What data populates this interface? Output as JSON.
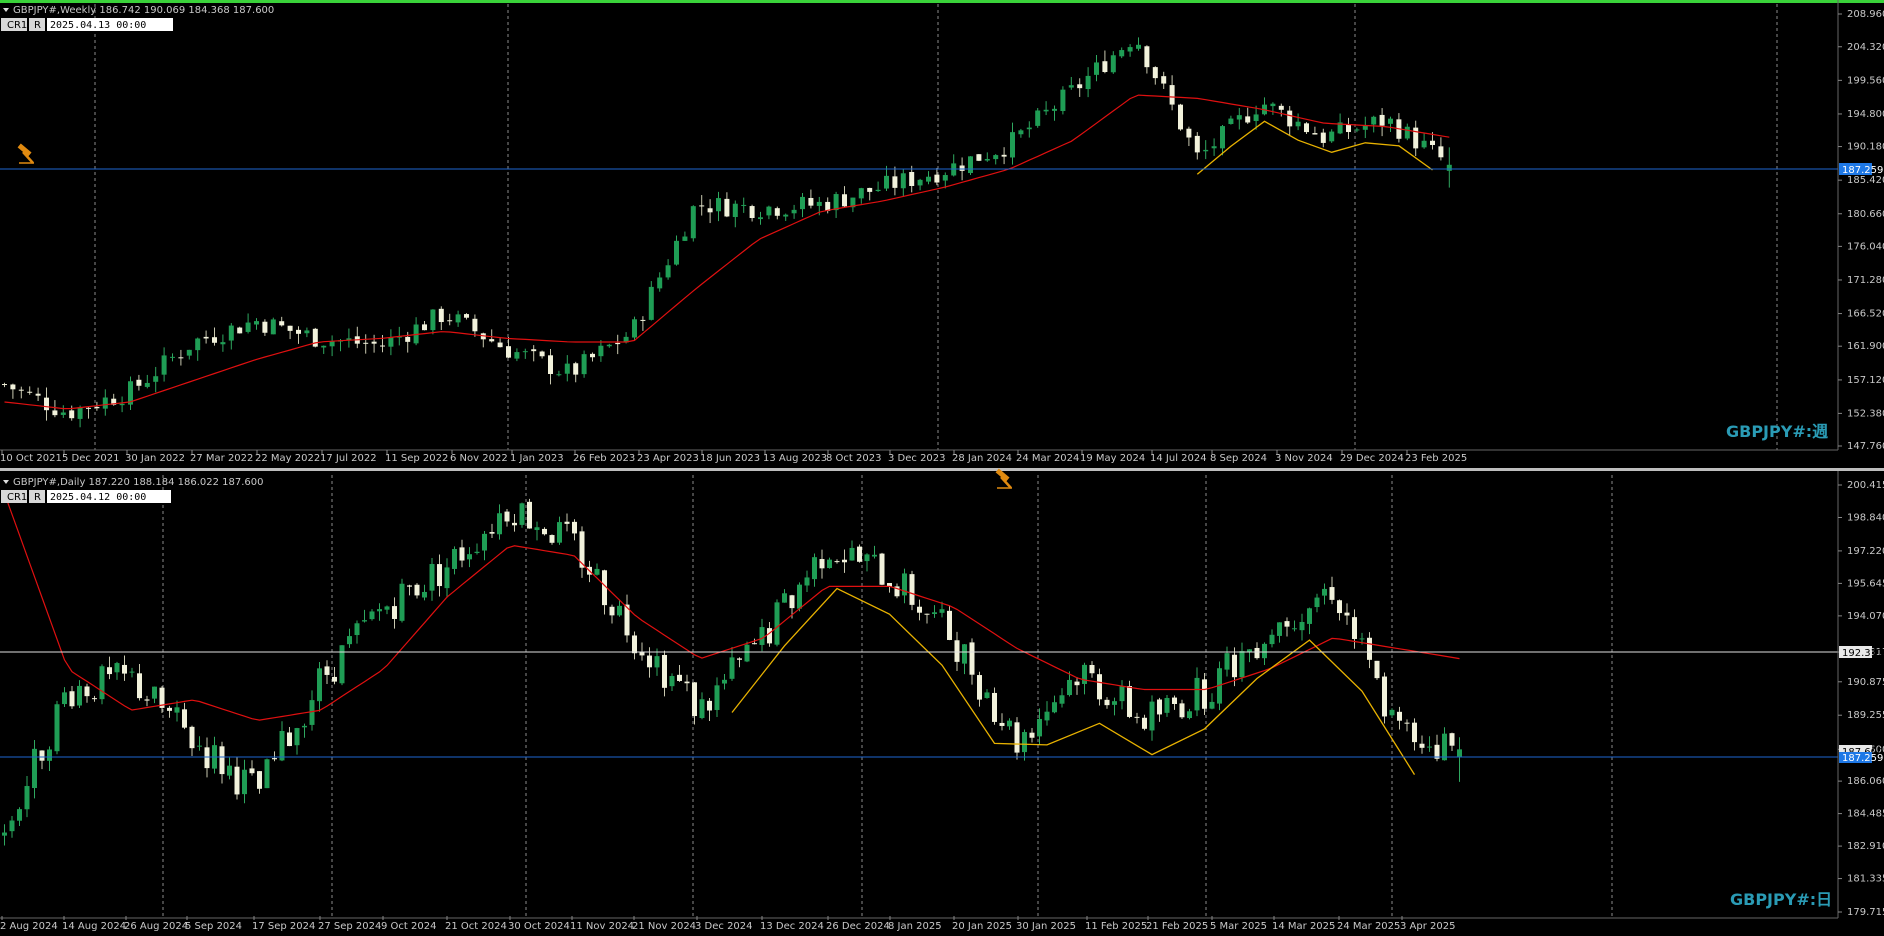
{
  "colors": {
    "background": "#000000",
    "bull": "#1f9d55",
    "bear": "#f2f2dc",
    "wick": "#9fbfa0",
    "ma": "#e01010",
    "zigzag": "#e8b200",
    "hline_blue": "#1e66d0",
    "hline_white": "#e0e0e0",
    "price_tag_blue": "#1e78e6",
    "watermark": "#2a9bb5",
    "top_border": "#3ad23a"
  },
  "panels": [
    {
      "id": "weekly",
      "header": "GBPJPY#,Weekly  186.742 190.069 184.368 187.600",
      "btn_cr": "CR1",
      "btn_r": "R",
      "date_box": "2025.04.13 00:00",
      "watermark": "GBPJPY#:週",
      "price_tag": "187.259",
      "y_ticks": [
        "208.960",
        "204.320",
        "199.560",
        "194.800",
        "190.180",
        "185.420",
        "180.660",
        "176.040",
        "171.280",
        "166.520",
        "161.900",
        "157.120",
        "152.380",
        "147.760"
      ],
      "x_labels": [
        "10 Oct 2021",
        "5 Dec 2021",
        "30 Jan 2022",
        "27 Mar 2022",
        "22 May 2022",
        "17 Jul 2022",
        "11 Sep 2022",
        "6 Nov 2022",
        "1 Jan 2023",
        "26 Feb 2023",
        "23 Apr 2023",
        "18 Jun 2023",
        "13 Aug 2023",
        "8 Oct 2023",
        "3 Dec 2023",
        "28 Jan 2024",
        "24 Mar 2024",
        "19 May 2024",
        "14 Jul 2024",
        "8 Sep 2024",
        "3 Nov 2024",
        "29 Dec 2024",
        "23 Feb 2025"
      ]
    },
    {
      "id": "daily",
      "header": "GBPJPY#,Daily  187.220 188.184 186.022 187.600",
      "btn_cr": "CR1",
      "btn_r": "R",
      "date_box": "2025.04.12 00:00",
      "watermark": "GBPJPY#:日",
      "price_tag": "187.259",
      "price_tag_2": "187.600",
      "price_tag_white": "192.317",
      "y_ticks": [
        "200.415",
        "198.840",
        "197.220",
        "195.645",
        "194.070",
        "192.317",
        "190.875",
        "189.255",
        "187.600",
        "186.060",
        "184.485",
        "182.910",
        "181.335",
        "179.715"
      ],
      "x_labels": [
        "2 Aug 2024",
        "14 Aug 2024",
        "26 Aug 2024",
        "5 Sep 2024",
        "17 Sep 2024",
        "27 Sep 2024",
        "9 Oct 2024",
        "21 Oct 2024",
        "30 Oct 2024",
        "11 Nov 2024",
        "21 Nov 2024",
        "3 Dec 2024",
        "13 Dec 2024",
        "26 Dec 2024",
        "8 Jan 2025",
        "20 Jan 2025",
        "30 Jan 2025",
        "11 Feb 2025",
        "21 Feb 2025",
        "5 Mar 2025",
        "14 Mar 2025",
        "24 Mar 2025",
        "3 Apr 2025"
      ]
    }
  ],
  "chart_data": [
    {
      "type": "candlestick",
      "title": "GBPJPY#,Weekly",
      "ohlc_last": {
        "open": 186.742,
        "high": 190.069,
        "low": 184.368,
        "close": 187.6
      },
      "ylim": [
        147.76,
        208.96
      ],
      "hline": 187.259,
      "x": [
        "10 Oct 2021",
        "5 Dec 2021",
        "30 Jan 2022",
        "27 Mar 2022",
        "22 May 2022",
        "17 Jul 2022",
        "11 Sep 2022",
        "6 Nov 2022",
        "1 Jan 2023",
        "26 Feb 2023",
        "23 Apr 2023",
        "18 Jun 2023",
        "13 Aug 2023",
        "8 Oct 2023",
        "3 Dec 2023",
        "28 Jan 2024",
        "24 Mar 2024",
        "19 May 2024",
        "14 Jul 2024",
        "8 Sep 2024",
        "3 Nov 2024",
        "29 Dec 2024",
        "23 Feb 2025",
        "last"
      ],
      "close": [
        156.5,
        152.5,
        155.5,
        162.5,
        165.5,
        163.0,
        162.0,
        166.5,
        161.5,
        158.0,
        164.0,
        182.0,
        181.5,
        182.0,
        184.5,
        187.0,
        190.5,
        198.0,
        206.0,
        188.5,
        196.5,
        191.5,
        194.0,
        187.6
      ],
      "ma": [
        154.0,
        153.0,
        154.0,
        157.0,
        160.0,
        162.5,
        163.0,
        164.0,
        163.0,
        162.5,
        162.5,
        170.0,
        177.0,
        181.0,
        182.5,
        184.5,
        187.0,
        191.0,
        197.5,
        197.0,
        195.5,
        193.5,
        193.0,
        191.5
      ]
    },
    {
      "type": "candlestick",
      "title": "GBPJPY#,Daily",
      "ohlc_last": {
        "open": 187.22,
        "high": 188.184,
        "low": 186.022,
        "close": 187.6
      },
      "ylim": [
        179.715,
        200.415
      ],
      "hlines": [
        192.317,
        187.259
      ],
      "x": [
        "2 Aug 2024",
        "14 Aug 2024",
        "26 Aug 2024",
        "5 Sep 2024",
        "17 Sep 2024",
        "27 Sep 2024",
        "9 Oct 2024",
        "21 Oct 2024",
        "30 Oct 2024",
        "11 Nov 2024",
        "21 Nov 2024",
        "3 Dec 2024",
        "13 Dec 2024",
        "26 Dec 2024",
        "8 Jan 2025",
        "20 Jan 2025",
        "30 Jan 2025",
        "11 Feb 2025",
        "21 Feb 2025",
        "5 Mar 2025",
        "14 Mar 2025",
        "24 Mar 2025",
        "3 Apr 2025",
        "last"
      ],
      "close": [
        183.5,
        190.5,
        191.0,
        188.0,
        185.5,
        191.0,
        194.5,
        196.5,
        199.5,
        197.5,
        193.0,
        189.5,
        193.0,
        197.5,
        196.0,
        193.0,
        188.0,
        191.5,
        189.0,
        190.5,
        193.5,
        195.5,
        188.5,
        187.6
      ],
      "ma": [
        200.0,
        191.5,
        189.5,
        190.0,
        189.0,
        189.5,
        191.5,
        195.0,
        197.5,
        197.0,
        194.0,
        192.0,
        193.0,
        195.5,
        195.5,
        194.5,
        192.5,
        191.0,
        190.5,
        190.5,
        191.5,
        193.0,
        192.5,
        192.0
      ]
    }
  ]
}
